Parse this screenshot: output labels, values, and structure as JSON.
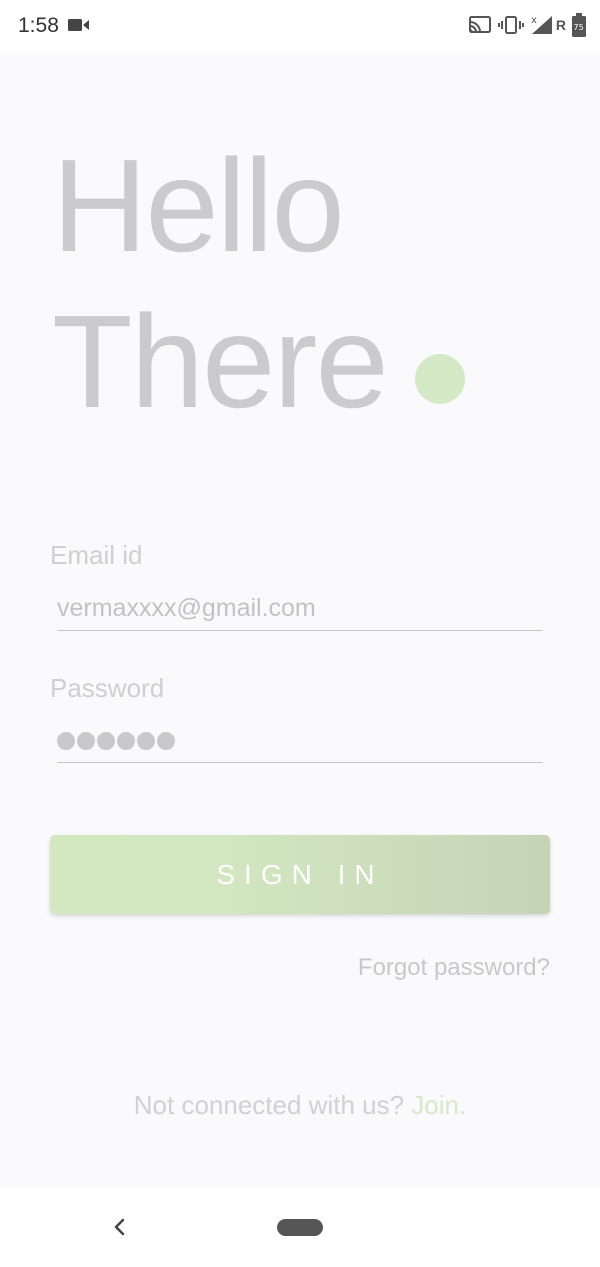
{
  "status_bar": {
    "time": "1:58",
    "network_letter": "R",
    "battery_level": "75",
    "icons": [
      "video-camera-icon",
      "cast-icon",
      "vibrate-icon",
      "signal-icon",
      "battery-icon"
    ]
  },
  "greeting": {
    "line1": "Hello",
    "line2": "There"
  },
  "email": {
    "label": "Email id",
    "value": "vermaxxxx@gmail.com"
  },
  "password": {
    "label": "Password",
    "masked_length": 6
  },
  "signin": {
    "label": "SIGN IN"
  },
  "forgot_password": "Forgot password?",
  "join": {
    "prompt": "Not connected with us?",
    "link": "Join."
  },
  "colors": {
    "background": "#faf9fb",
    "accent_green": "#d6e9c6",
    "text_muted": "#cbcacd"
  },
  "nav_bar": {
    "icons": [
      "back-icon",
      "home-pill-icon"
    ]
  }
}
